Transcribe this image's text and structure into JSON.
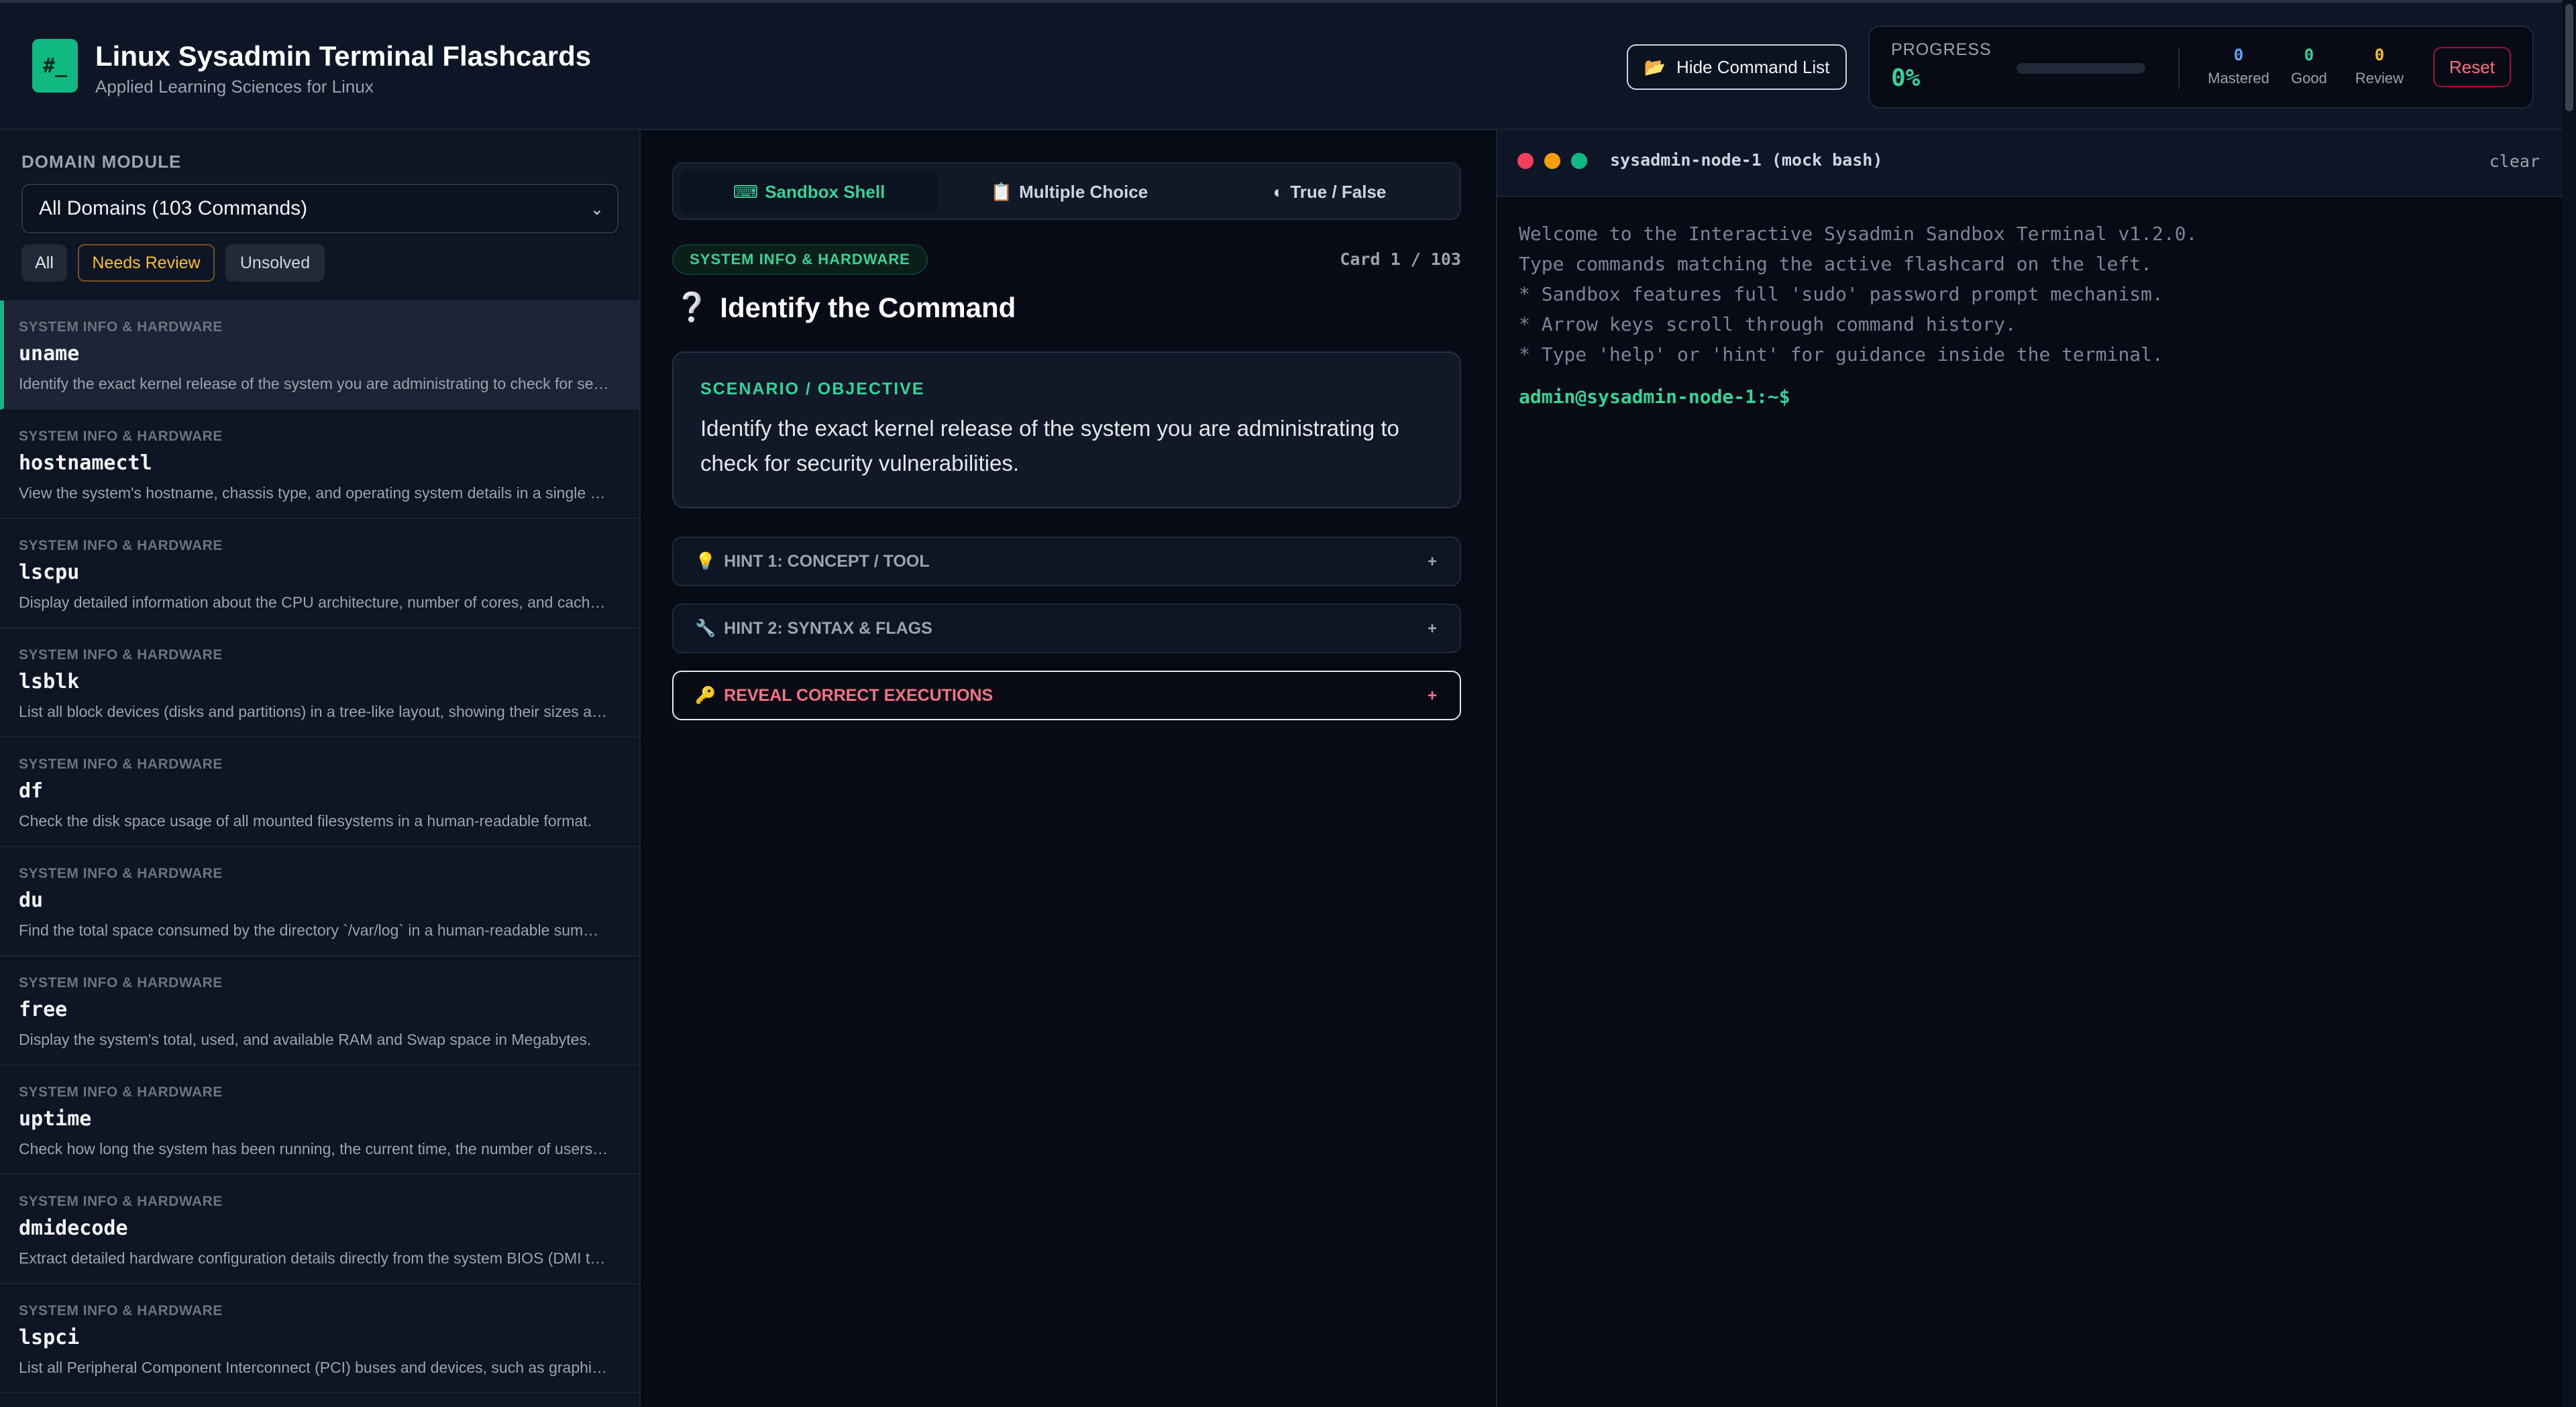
{
  "app": {
    "logo_text": "#_",
    "title": "Linux Sysadmin Terminal Flashcards",
    "subtitle": "Applied Learning Sciences for Linux"
  },
  "header": {
    "hide_button_icon": "📂",
    "hide_button_label": "Hide Command List",
    "progress_label": "PROGRESS",
    "progress_value": "0%",
    "progress_fraction": 0,
    "stats": [
      {
        "value": "0",
        "label": "Mastered",
        "color": "#60a5fa"
      },
      {
        "value": "0",
        "label": "Good",
        "color": "#34d399"
      },
      {
        "value": "0",
        "label": "Review",
        "color": "#fbbf24"
      }
    ],
    "reset_label": "Reset"
  },
  "sidebar": {
    "domain_label": "DOMAIN MODULE",
    "domain_selected": "All Domains (103 Commands)",
    "filters": [
      "All",
      "Needs Review",
      "Unsolved"
    ],
    "commands": [
      {
        "category": "SYSTEM INFO & HARDWARE",
        "name": "uname",
        "desc": "Identify the exact kernel release of the system you are administrating to check for security vulnerabilities."
      },
      {
        "category": "SYSTEM INFO & HARDWARE",
        "name": "hostnamectl",
        "desc": "View the system's hostname, chassis type, and operating system details in a single command."
      },
      {
        "category": "SYSTEM INFO & HARDWARE",
        "name": "lscpu",
        "desc": "Display detailed information about the CPU architecture, number of cores, and cache sizes."
      },
      {
        "category": "SYSTEM INFO & HARDWARE",
        "name": "lsblk",
        "desc": "List all block devices (disks and partitions) in a tree-like layout, showing their sizes and mount points."
      },
      {
        "category": "SYSTEM INFO & HARDWARE",
        "name": "df",
        "desc": "Check the disk space usage of all mounted filesystems in a human-readable format."
      },
      {
        "category": "SYSTEM INFO & HARDWARE",
        "name": "du",
        "desc": "Find the total space consumed by the directory `/var/log` in a human-readable summary."
      },
      {
        "category": "SYSTEM INFO & HARDWARE",
        "name": "free",
        "desc": "Display the system's total, used, and available RAM and Swap space in Megabytes."
      },
      {
        "category": "SYSTEM INFO & HARDWARE",
        "name": "uptime",
        "desc": "Check how long the system has been running, the current time, the number of users and load averages."
      },
      {
        "category": "SYSTEM INFO & HARDWARE",
        "name": "dmidecode",
        "desc": "Extract detailed hardware configuration details directly from the system BIOS (DMI tables)."
      },
      {
        "category": "SYSTEM INFO & HARDWARE",
        "name": "lspci",
        "desc": "List all Peripheral Component Interconnect (PCI) buses and devices, such as graphics cards."
      }
    ]
  },
  "center": {
    "tabs": [
      {
        "icon": "⌨",
        "label": "Sandbox Shell"
      },
      {
        "icon": "📋",
        "label": "Multiple Choice"
      },
      {
        "icon": "◐",
        "label": "True / False"
      }
    ],
    "category_badge": "SYSTEM INFO & HARDWARE",
    "card_counter": "Card 1 / 103",
    "question_mark": "❔",
    "question_title": "Identify the Command",
    "scenario_label": "SCENARIO / OBJECTIVE",
    "scenario_text": "Identify the exact kernel release of the system you are administrating to check for security vulnerabilities.",
    "hint1_icon": "💡",
    "hint1_label": "HINT 1: CONCEPT / TOOL",
    "hint2_icon": "🔧",
    "hint2_label": "HINT 2: SYNTAX & FLAGS",
    "reveal_icon": "🔑",
    "reveal_label": "REVEAL CORRECT EXECUTIONS",
    "expand_symbol": "+"
  },
  "terminal": {
    "title": "sysadmin-node-1 (mock bash)",
    "clear_label": "clear",
    "lines": [
      "Welcome to the Interactive Sysadmin Sandbox Terminal v1.2.0.",
      "Type commands matching the active flashcard on the left.",
      "* Sandbox features full 'sudo' password prompt mechanism.",
      "* Arrow keys scroll through command history.",
      "* Type 'help' or 'hint' for guidance inside the terminal."
    ],
    "prompt": "admin@sysadmin-node-1:~$"
  }
}
